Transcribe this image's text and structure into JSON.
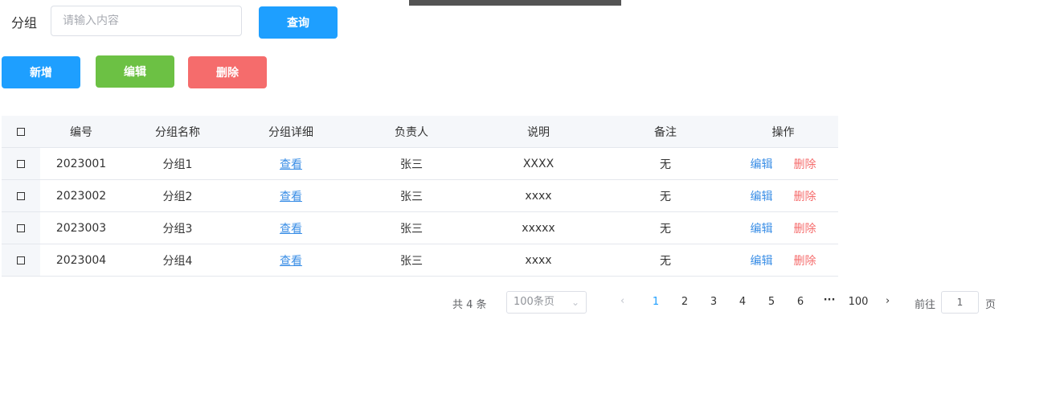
{
  "search": {
    "label": "分组",
    "placeholder": "请输入内容",
    "query_button": "查询"
  },
  "toolbar": {
    "add_label": "新增",
    "edit_label": "编辑",
    "delete_label": "删除"
  },
  "table": {
    "checkbox_glyph": "",
    "columns": [
      "编号",
      "分组名称",
      "分组详细",
      "负责人",
      "说明",
      "备注",
      "操作"
    ],
    "rows": [
      {
        "id": "2023001",
        "name": "分组1",
        "detail": "查看",
        "owner": "张三",
        "desc": "XXXX",
        "note": "无",
        "edit": "编辑",
        "delete": "删除"
      },
      {
        "id": "2023002",
        "name": "分组2",
        "detail": "查看",
        "owner": "张三",
        "desc": "xxxx",
        "note": "无",
        "edit": "编辑",
        "delete": "删除"
      },
      {
        "id": "2023003",
        "name": "分组3",
        "detail": "查看",
        "owner": "张三",
        "desc": "xxxxx",
        "note": "无",
        "edit": "编辑",
        "delete": "删除"
      },
      {
        "id": "2023004",
        "name": "分组4",
        "detail": "查看",
        "owner": "张三",
        "desc": "xxxx",
        "note": "无",
        "edit": "编辑",
        "delete": "删除"
      }
    ]
  },
  "pagination": {
    "total_text": "共 4 条",
    "page_size": "100条页",
    "pages": [
      "1",
      "2",
      "3",
      "4",
      "5",
      "6"
    ],
    "active_page": "1",
    "ellipsis": "···",
    "last_page": "100",
    "goto_label": "前往",
    "goto_value": "1",
    "goto_unit": "页"
  },
  "colors": {
    "primary": "#1e9fff",
    "success": "#6cc144",
    "danger": "#f56c6c"
  }
}
